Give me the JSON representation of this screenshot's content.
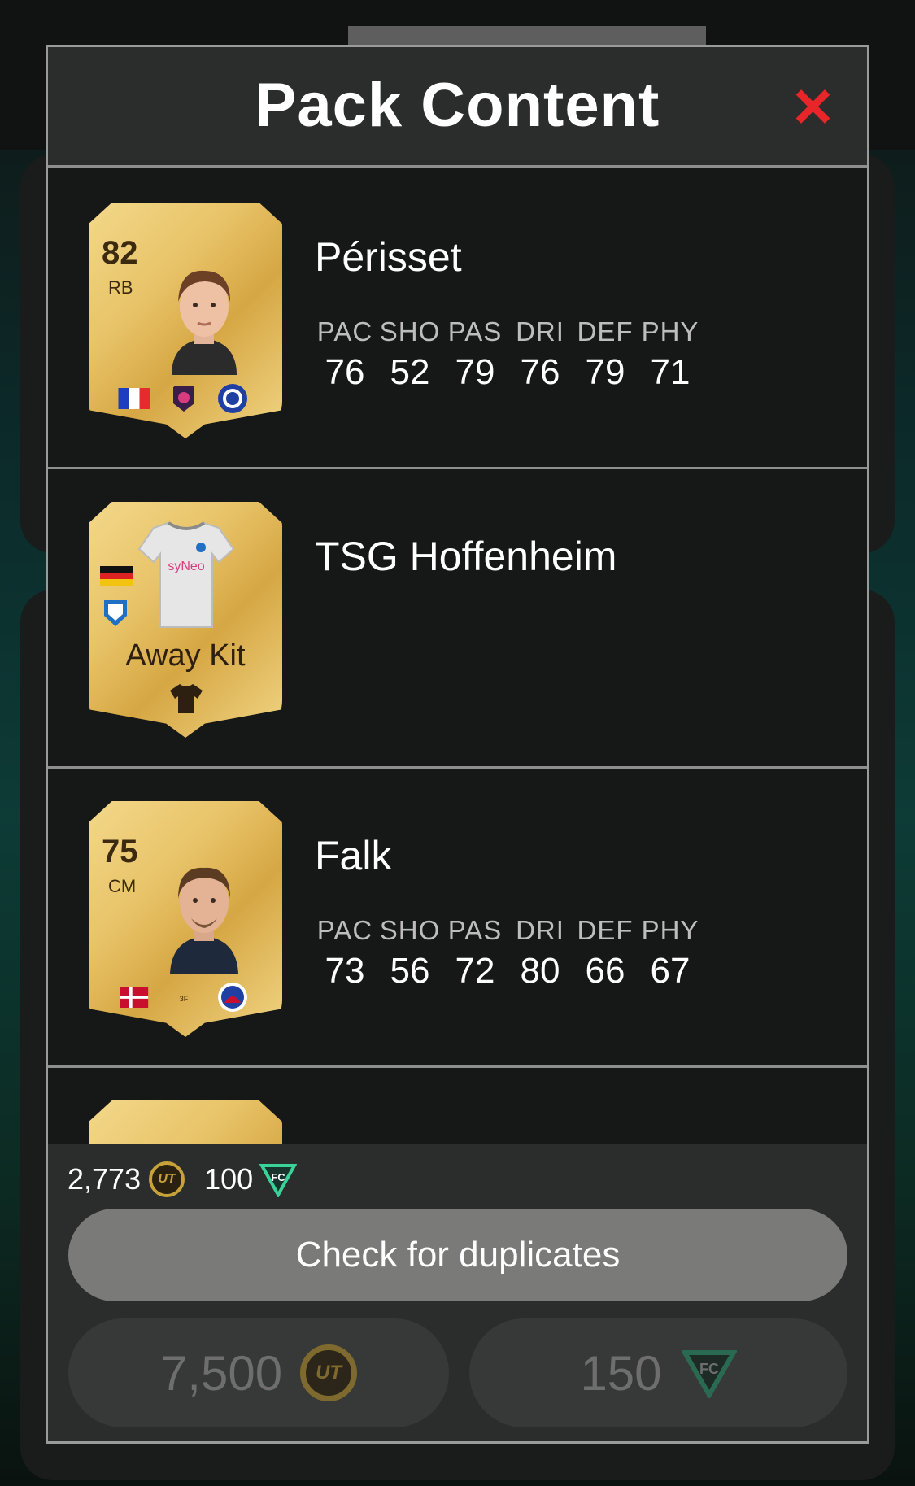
{
  "modal": {
    "title": "Pack Content"
  },
  "items": [
    {
      "type": "player",
      "name": "Périsset",
      "card": {
        "rating": "82",
        "position": "RB"
      },
      "stats": [
        {
          "label": "PAC",
          "value": "76"
        },
        {
          "label": "SHO",
          "value": "52"
        },
        {
          "label": "PAS",
          "value": "79"
        },
        {
          "label": "DRI",
          "value": "76"
        },
        {
          "label": "DEF",
          "value": "79"
        },
        {
          "label": "PHY",
          "value": "71"
        }
      ]
    },
    {
      "type": "kit",
      "name": "TSG Hoffenheim",
      "card": {
        "kit_label": "Away Kit"
      }
    },
    {
      "type": "player",
      "name": "Falk",
      "card": {
        "rating": "75",
        "position": "CM"
      },
      "stats": [
        {
          "label": "PAC",
          "value": "73"
        },
        {
          "label": "SHO",
          "value": "56"
        },
        {
          "label": "PAS",
          "value": "72"
        },
        {
          "label": "DRI",
          "value": "80"
        },
        {
          "label": "DEF",
          "value": "66"
        },
        {
          "label": "PHY",
          "value": "67"
        }
      ]
    }
  ],
  "footer": {
    "coins": "2,773",
    "fc_points": "100",
    "check_duplicates_label": "Check for duplicates",
    "buy_coins_price": "7,500",
    "buy_points_price": "150"
  },
  "colors": {
    "close": "#e8262a",
    "gold": "#e8c368"
  }
}
